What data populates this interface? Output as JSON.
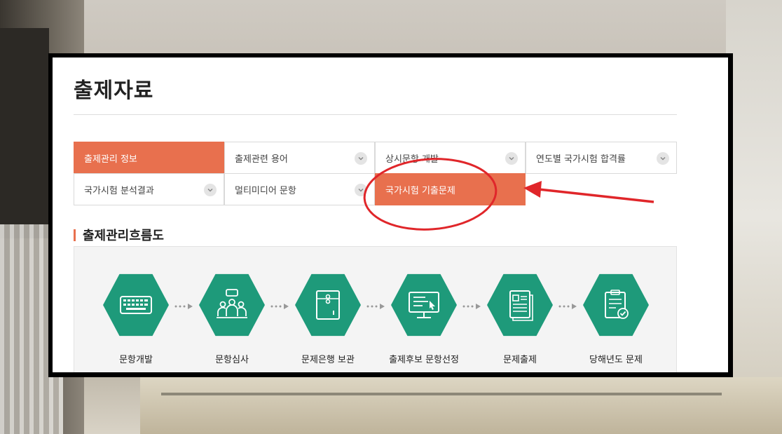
{
  "page": {
    "title": "출제자료"
  },
  "menu": [
    {
      "label": "출제관리 정보",
      "active": true,
      "chevron": false
    },
    {
      "label": "출제관련 용어",
      "active": false,
      "chevron": true
    },
    {
      "label": "상시문항 개발",
      "active": false,
      "chevron": true
    },
    {
      "label": "연도별 국가시험 합격률",
      "active": false,
      "chevron": true
    },
    {
      "label": "국가시험 분석결과",
      "active": false,
      "chevron": true
    },
    {
      "label": "멀티미디어 문항",
      "active": false,
      "chevron": true
    },
    {
      "label": "국가시험 기출문제",
      "active": true,
      "chevron": false
    }
  ],
  "section": {
    "title": "출제관리흐름도"
  },
  "flow": [
    {
      "label": "문항개발",
      "icon": "keyboard-icon"
    },
    {
      "label": "문항심사",
      "icon": "meeting-icon"
    },
    {
      "label": "문제은행 보관",
      "icon": "envelope-icon"
    },
    {
      "label": "출제후보 문항선정",
      "icon": "monitor-icon"
    },
    {
      "label": "문제출제",
      "icon": "document-icon"
    },
    {
      "label": "당해년도 문제",
      "icon": "clipboard-check-icon"
    }
  ],
  "colors": {
    "accent": "#e8704e",
    "hex": "#1e9a7a",
    "annotation": "#e0262a"
  }
}
